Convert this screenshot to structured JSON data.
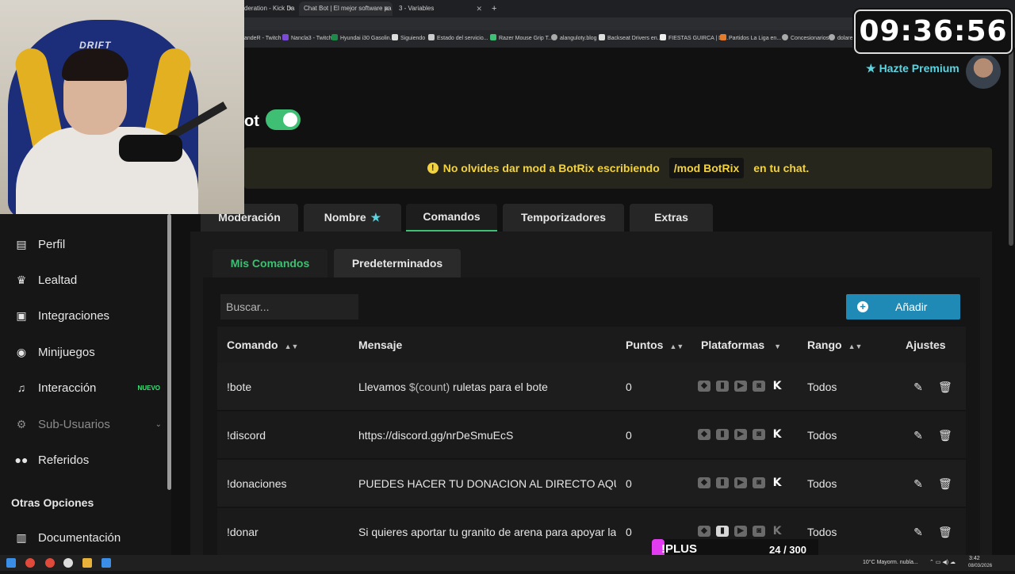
{
  "browser": {
    "tabs": [
      {
        "label": "deration - Kick Da",
        "active": false
      },
      {
        "label": "Chat Bot | El mejor software pa",
        "active": true
      },
      {
        "label": "3 - Variables",
        "active": false
      }
    ],
    "bookmarks": [
      "andeR - Twitch",
      "Nancla3 - Twitch",
      "Hyundai i30 Gasolin...",
      "Siguiendo",
      "Estado del servicio...",
      "Razer Mouse Grip T...",
      "alanguloty.blog",
      "Backseat Drivers en...",
      "FIESTAS GUIRCA | Di...",
      "Partidos La Liga en...",
      "Concesionarios",
      "dolares"
    ]
  },
  "overlay": {
    "clock": "09:36:56",
    "chair_logo": "DRIFT",
    "plus_label": "!PLUS",
    "plus_count": "24 / 300"
  },
  "header": {
    "premium_label": "Hazte Premium"
  },
  "bot": {
    "title_fragment": "ot",
    "enabled": true
  },
  "notice": {
    "text_before": "No olvides dar mod a BotRix escribiendo",
    "code": "/mod BotRix",
    "text_after": "en tu chat."
  },
  "sidebar": {
    "items": [
      {
        "label": "Perfil",
        "icon": "id-card-icon",
        "glyph": "▤"
      },
      {
        "label": "Lealtad",
        "icon": "trophy-icon",
        "glyph": "♛"
      },
      {
        "label": "Integraciones",
        "icon": "puzzle-icon",
        "glyph": "▣"
      },
      {
        "label": "Minijuegos",
        "icon": "gamepad-icon",
        "glyph": "◉"
      },
      {
        "label": "Interacción",
        "icon": "music-icon",
        "glyph": "♫",
        "badge": "NUEVO"
      },
      {
        "label": "Sub-Usuarios",
        "icon": "users-cog-icon",
        "glyph": "⚙",
        "disabled": true
      },
      {
        "label": "Referidos",
        "icon": "users-icon",
        "glyph": "👥"
      }
    ],
    "section_title": "Otras Opciones",
    "extra_items": [
      {
        "label": "Documentación",
        "icon": "scroll-icon",
        "glyph": "▥"
      }
    ]
  },
  "main": {
    "tabs": [
      {
        "label": "Moderación",
        "active": false
      },
      {
        "label": "Nombre",
        "active": false,
        "star": true
      },
      {
        "label": "Comandos",
        "active": true
      },
      {
        "label": "Temporizadores",
        "active": false
      },
      {
        "label": "Extras",
        "active": false
      }
    ],
    "sub_tabs": [
      {
        "label": "Mis Comandos",
        "active": true
      },
      {
        "label": "Predeterminados",
        "active": false
      }
    ],
    "search_placeholder": "Buscar...",
    "add_label": "Añadir"
  },
  "table": {
    "headers": {
      "command": "Comando",
      "message": "Mensaje",
      "points": "Puntos",
      "platforms": "Plataformas",
      "rank": "Rango",
      "settings": "Ajustes"
    },
    "rows": [
      {
        "command": "!bote",
        "message_pre": "Llevamos ",
        "message_var": "$(count)",
        "message_post": " ruletas para el bote",
        "points": "0",
        "rank": "Todos"
      },
      {
        "command": "!discord",
        "message_pre": "https://discord.gg/nrDeSmuEcS",
        "message_var": "",
        "message_post": "",
        "points": "0",
        "rank": "Todos"
      },
      {
        "command": "!donaciones",
        "message_pre": "PUEDES HACER TU DONACION AL DIRECTO AQUI: h",
        "message_var": "",
        "message_post": "",
        "points": "0",
        "rank": "Todos"
      },
      {
        "command": "!donar",
        "message_pre": "Si quieres aportar tu granito de arena para apoyar la",
        "message_var": "",
        "message_post": "",
        "points": "0",
        "rank": "Todos"
      }
    ]
  },
  "taskbar": {
    "weather": "10°C  Mayorm. nubla...",
    "time": "3:42",
    "date": "08/03/2026"
  },
  "colors": {
    "accent_green": "#3fbf73",
    "premium_cyan": "#5ed3e0",
    "notice_yellow": "#f2d33f",
    "add_blue": "#1e8ab5",
    "plus_magenta": "#e23cf0"
  }
}
